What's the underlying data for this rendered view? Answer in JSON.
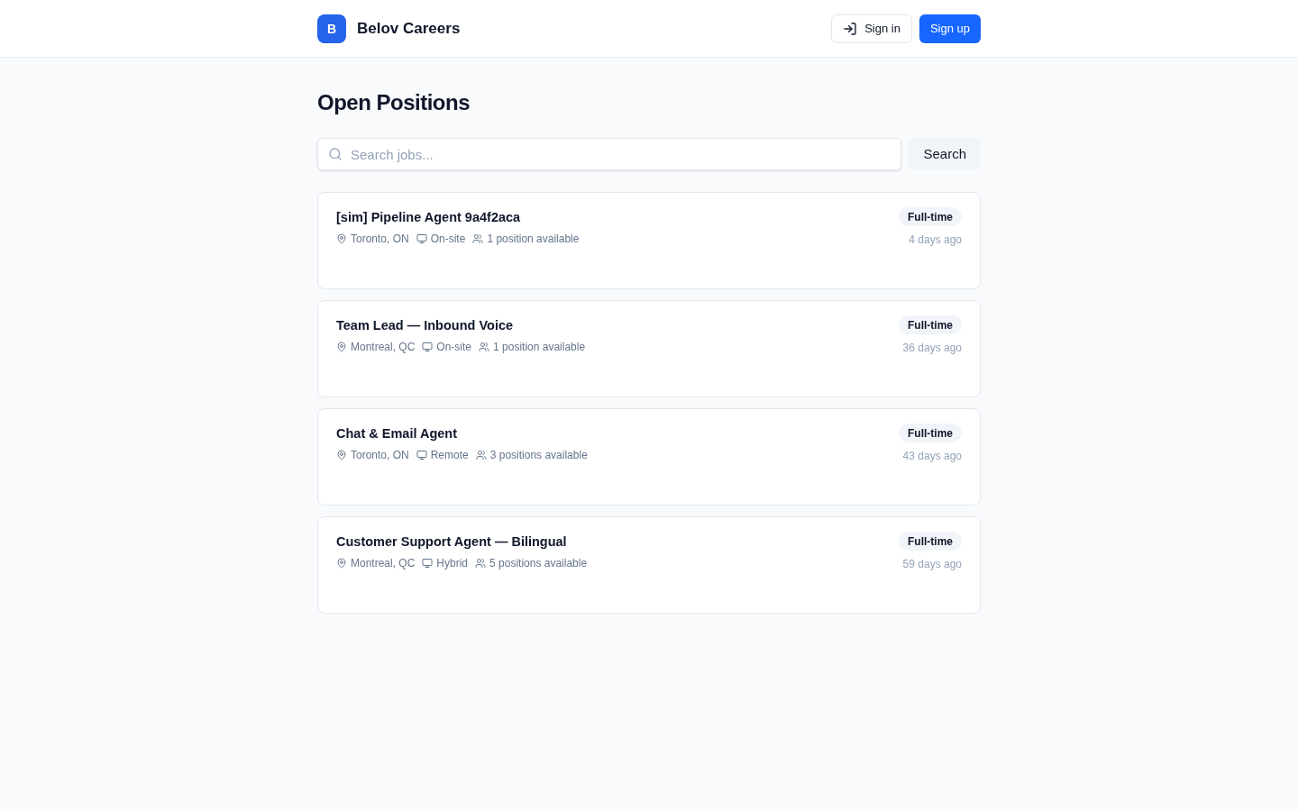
{
  "header": {
    "logo_letter": "B",
    "brand": "Belov Careers",
    "sign_in": "Sign in",
    "sign_up": "Sign up"
  },
  "page_title": "Open Positions",
  "search": {
    "placeholder": "Search jobs...",
    "button": "Search"
  },
  "jobs": [
    {
      "title": "[sim] Pipeline Agent 9a4f2aca",
      "location": "Toronto, ON",
      "work_mode": "On-site",
      "openings": "1 position available",
      "type": "Full-time",
      "posted": "4 days ago"
    },
    {
      "title": "Team Lead — Inbound Voice",
      "location": "Montreal, QC",
      "work_mode": "On-site",
      "openings": "1 position available",
      "type": "Full-time",
      "posted": "36 days ago"
    },
    {
      "title": "Chat & Email Agent",
      "location": "Toronto, ON",
      "work_mode": "Remote",
      "openings": "3 positions available",
      "type": "Full-time",
      "posted": "43 days ago"
    },
    {
      "title": "Customer Support Agent — Bilingual",
      "location": "Montreal, QC",
      "work_mode": "Hybrid",
      "openings": "5 positions available",
      "type": "Full-time",
      "posted": "59 days ago"
    }
  ]
}
